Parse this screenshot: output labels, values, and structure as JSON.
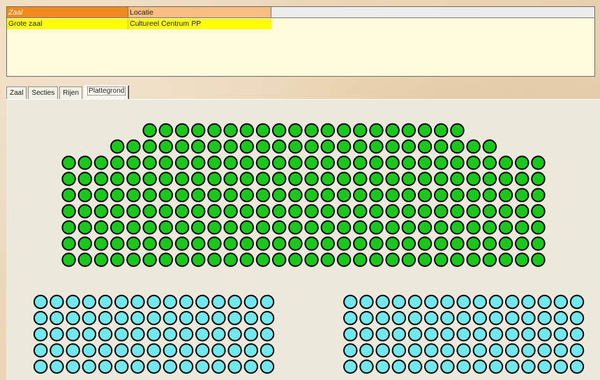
{
  "table": {
    "columns": [
      "Zaal",
      "Locatie"
    ],
    "rows": [
      [
        "Grote zaal",
        "Cultureel Centrum PP"
      ]
    ]
  },
  "tabs": [
    "Zaal",
    "Secties",
    "Rijen",
    "Plattegrond"
  ],
  "active_tab": "Plattegrond",
  "colors": {
    "header_zaal": "#f08a1a",
    "header_locatie": "#f8bd80",
    "selected_row": "#ffff00",
    "seat_main": "#19c919",
    "seat_side": "#6fe8ee",
    "seat_outline": "#000000"
  },
  "seatmap": {
    "sections": [
      {
        "name": "main",
        "color": "seat_main",
        "rows": [
          20,
          24,
          30,
          30,
          30,
          30,
          30,
          30,
          30
        ]
      },
      {
        "name": "left",
        "color": "seat_side",
        "rows": [
          15,
          15,
          15,
          15,
          15
        ]
      },
      {
        "name": "right",
        "color": "seat_side",
        "rows": [
          15,
          15,
          15,
          15,
          15
        ]
      }
    ]
  }
}
